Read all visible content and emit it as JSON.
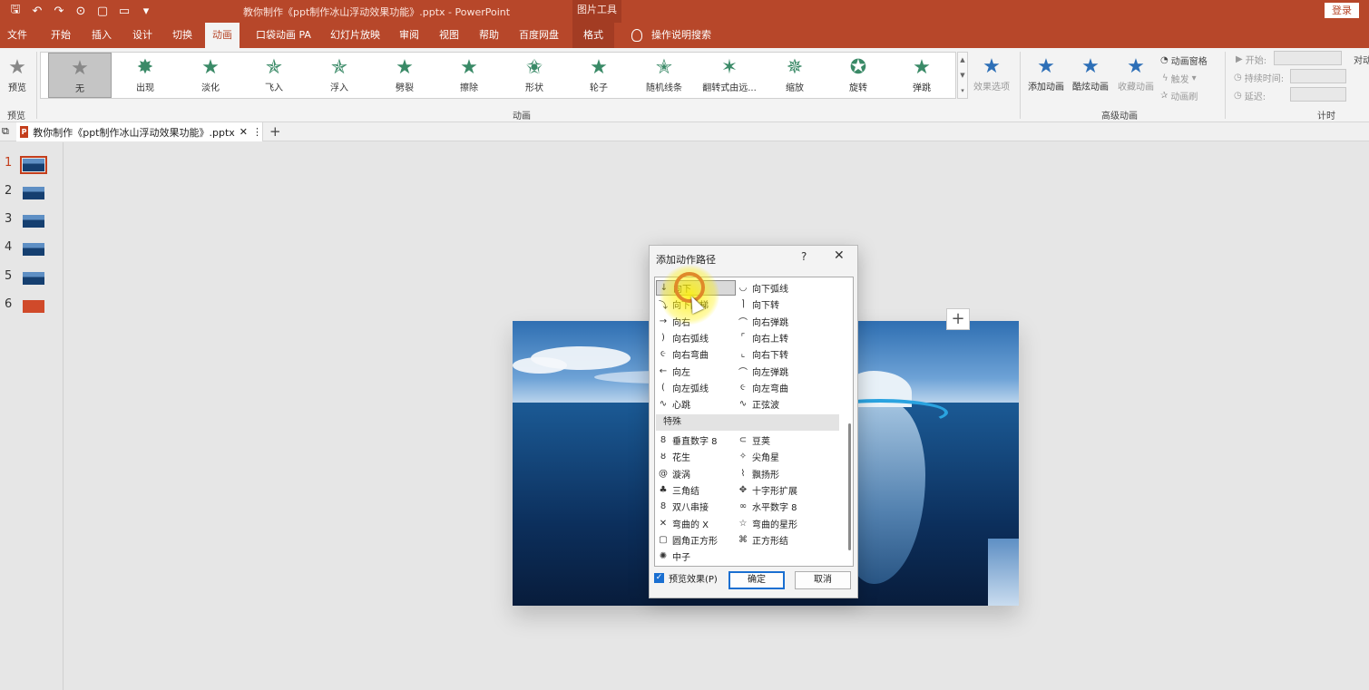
{
  "window": {
    "title": "教你制作《ppt制作冰山浮动效果功能》.pptx  -  PowerPoint",
    "tools_label": "图片工具",
    "login_label": "登录"
  },
  "menu": {
    "tabs": [
      "文件",
      "开始",
      "插入",
      "设计",
      "切换",
      "动画",
      "口袋动画 PA",
      "幻灯片放映",
      "审阅",
      "视图",
      "帮助",
      "百度网盘",
      "格式"
    ],
    "active": "动画",
    "search_label": "操作说明搜索"
  },
  "ribbon": {
    "preview_label": "预览",
    "preview_group": "预览",
    "animation_group": "动画",
    "advanced_group": "高级动画",
    "timing_group": "计时",
    "animations": [
      "无",
      "出现",
      "淡化",
      "飞入",
      "浮入",
      "劈裂",
      "擦除",
      "形状",
      "轮子",
      "随机线条",
      "翻转式由远...",
      "缩放",
      "旋转",
      "弹跳"
    ],
    "effect_options": "效果选项",
    "add_animation": "添加动画",
    "cool_animation": "酷炫动画",
    "fav_animation": "收藏动画",
    "animation_pane": "动画窗格",
    "trigger": "触发",
    "animation_painter": "动画刷",
    "start_label": "开始:",
    "duration_label": "持续时间:",
    "delay_label": "延迟:",
    "reorder_label": "对动"
  },
  "doc_tab": {
    "icon": "P",
    "name": "教你制作《ppt制作冰山浮动效果功能》.pptx"
  },
  "slides": [
    "1",
    "2",
    "3",
    "4",
    "5",
    "6"
  ],
  "dialog": {
    "title": "添加动作路径",
    "help": "?",
    "left_items": [
      "向下",
      "向下阶梯",
      "向右",
      "向右弧线",
      "向右弯曲",
      "向左",
      "向左弧线",
      "心跳"
    ],
    "right_items": [
      "向下弧线",
      "向下转",
      "向右弹跳",
      "向右上转",
      "向右下转",
      "向左弹跳",
      "向左弯曲",
      "正弦波"
    ],
    "section": "特殊",
    "special_left": [
      "垂直数字 8",
      "花生",
      "漩涡",
      "三角结",
      "双八串接",
      "弯曲的 X",
      "圆角正方形",
      "中子"
    ],
    "special_right": [
      "豆荚",
      "尖角星",
      "飘扬形",
      "十字形扩展",
      "水平数字 8",
      "弯曲的星形",
      "正方形结"
    ],
    "preview_checkbox": "预览效果(P)",
    "ok": "确定",
    "cancel": "取消"
  }
}
